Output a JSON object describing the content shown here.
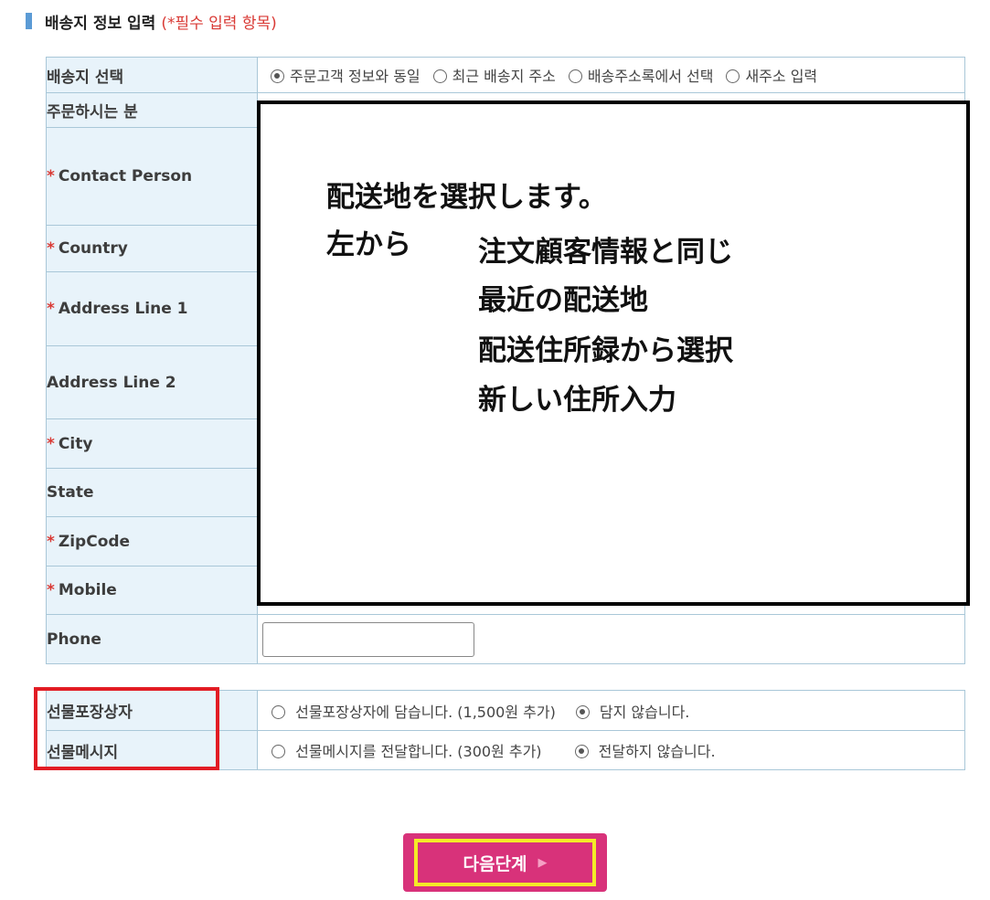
{
  "section": {
    "title": "배송지 정보 입력",
    "required_note": "(*필수 입력 항목)"
  },
  "form": {
    "ship_select": {
      "label": "배송지 선택",
      "options": [
        {
          "label": "주문고객 정보와 동일",
          "selected": true
        },
        {
          "label": "최근 배송지 주소",
          "selected": false
        },
        {
          "label": "배송주소록에서 선택",
          "selected": false
        },
        {
          "label": "새주소 입력",
          "selected": false
        }
      ]
    },
    "orderer_label": "주문하시는 분",
    "required_mark": "*",
    "contact_label": "Contact Person",
    "country_label": "Country",
    "address1_label": "Address Line 1",
    "address2_label": "Address Line 2",
    "city_label": "City",
    "state_label": "State",
    "zipcode_label": "ZipCode",
    "mobile_label": "Mobile",
    "phone_label": "Phone",
    "phone_value": ""
  },
  "overlay": {
    "line1": "配送地を選択します。",
    "line2": "左から",
    "items": [
      "注文顧客情報と同じ",
      "最近の配送地",
      "配送住所録から選択",
      "新しい住所入力"
    ]
  },
  "gift": {
    "box": {
      "label": "선물포장상자",
      "options": [
        {
          "label": "선물포장상자에 담습니다. (1,500원 추가)",
          "selected": false
        },
        {
          "label": "담지 않습니다.",
          "selected": true
        }
      ]
    },
    "message": {
      "label": "선물메시지",
      "options": [
        {
          "label": "선물메시지를 전달합니다. (300원 추가)",
          "selected": false
        },
        {
          "label": "전달하지 않습니다.",
          "selected": true
        }
      ]
    }
  },
  "next_button": {
    "label": "다음단계",
    "arrow": "▶"
  }
}
